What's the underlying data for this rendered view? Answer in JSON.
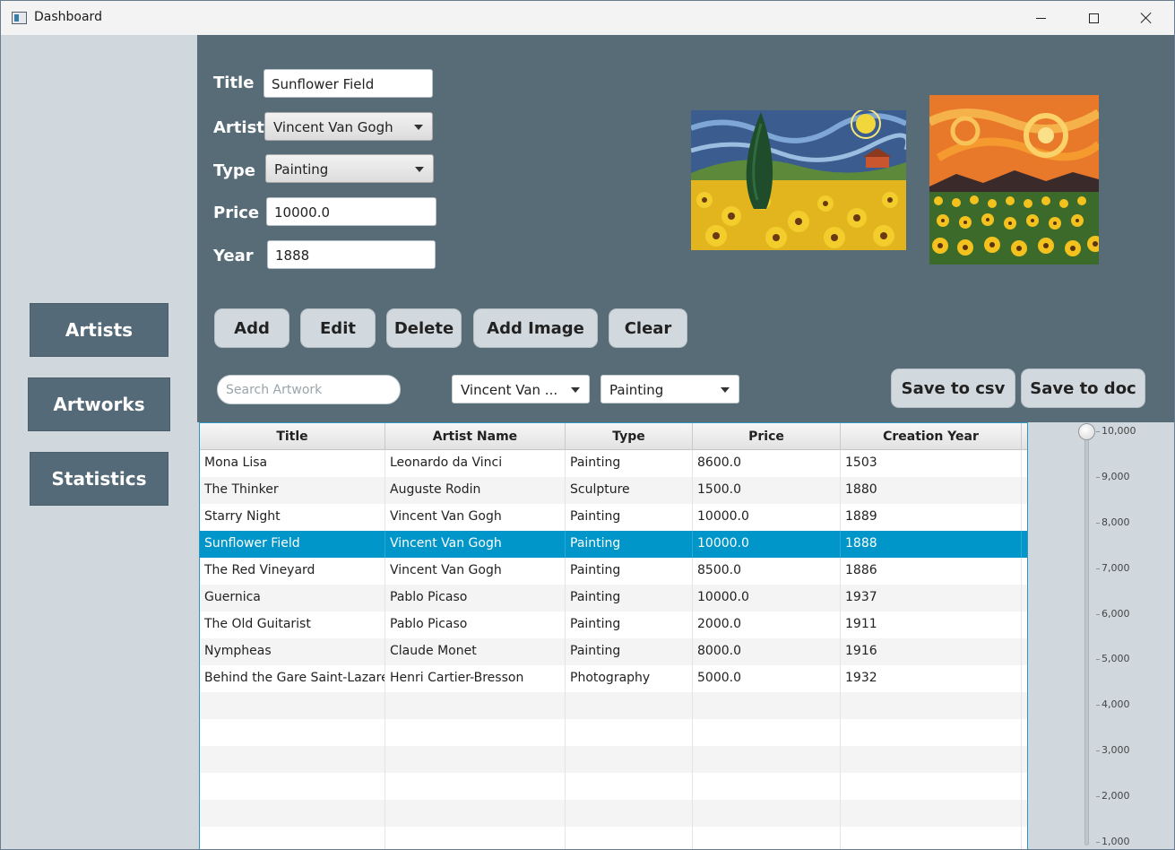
{
  "window": {
    "title": "Dashboard"
  },
  "sidebar": {
    "items": [
      {
        "label": "Artists"
      },
      {
        "label": "Artworks"
      },
      {
        "label": "Statistics"
      }
    ]
  },
  "form": {
    "title": {
      "label": "Title",
      "value": "Sunflower Field"
    },
    "artist": {
      "label": "Artist",
      "value": "Vincent Van Gogh"
    },
    "type": {
      "label": "Type",
      "value": "Painting"
    },
    "price": {
      "label": "Price",
      "value": "10000.0"
    },
    "year": {
      "label": "Year",
      "value": "1888"
    }
  },
  "actions": {
    "add": "Add",
    "edit": "Edit",
    "delete": "Delete",
    "add_image": "Add Image",
    "clear": "Clear"
  },
  "filters": {
    "search_placeholder": "Search Artwork",
    "artist_value": "Vincent Van ...",
    "type_value": "Painting",
    "save_csv": "Save to csv",
    "save_doc": "Save to doc"
  },
  "table": {
    "columns": [
      "Title",
      "Artist Name",
      "Type",
      "Price",
      "Creation Year"
    ],
    "rows": [
      [
        "Mona Lisa",
        "Leonardo da Vinci",
        "Painting",
        "8600.0",
        "1503"
      ],
      [
        "The Thinker",
        "Auguste Rodin",
        "Sculpture",
        "1500.0",
        "1880"
      ],
      [
        "Starry Night",
        "Vincent Van Gogh",
        "Painting",
        "10000.0",
        "1889"
      ],
      [
        "Sunflower Field",
        "Vincent Van Gogh",
        "Painting",
        "10000.0",
        "1888"
      ],
      [
        "The Red Vineyard",
        "Vincent Van Gogh",
        "Painting",
        "8500.0",
        "1886"
      ],
      [
        "Guernica",
        "Pablo Picaso",
        "Painting",
        "10000.0",
        "1937"
      ],
      [
        "The Old Guitarist",
        "Pablo Picaso",
        "Painting",
        "2000.0",
        "1911"
      ],
      [
        "Nympheas",
        "Claude Monet",
        "Painting",
        "8000.0",
        "1916"
      ],
      [
        "Behind the Gare Saint-Lazare",
        "Henri Cartier-Bresson",
        "Photography",
        "5000.0",
        "1932"
      ]
    ],
    "selected_index": 3,
    "empty_rows": 6
  },
  "price_slider": {
    "value": 10000,
    "min": 1000,
    "max": 10000,
    "tick_labels": [
      "10,000",
      "9,000",
      "8,000",
      "7,000",
      "6,000",
      "5,000",
      "4,000",
      "3,000",
      "2,000",
      "1,000"
    ]
  },
  "colors": {
    "panel": "#586c78",
    "sidebar": "#d0d8de",
    "nav_button": "#546a78",
    "selection": "#0096c9"
  }
}
